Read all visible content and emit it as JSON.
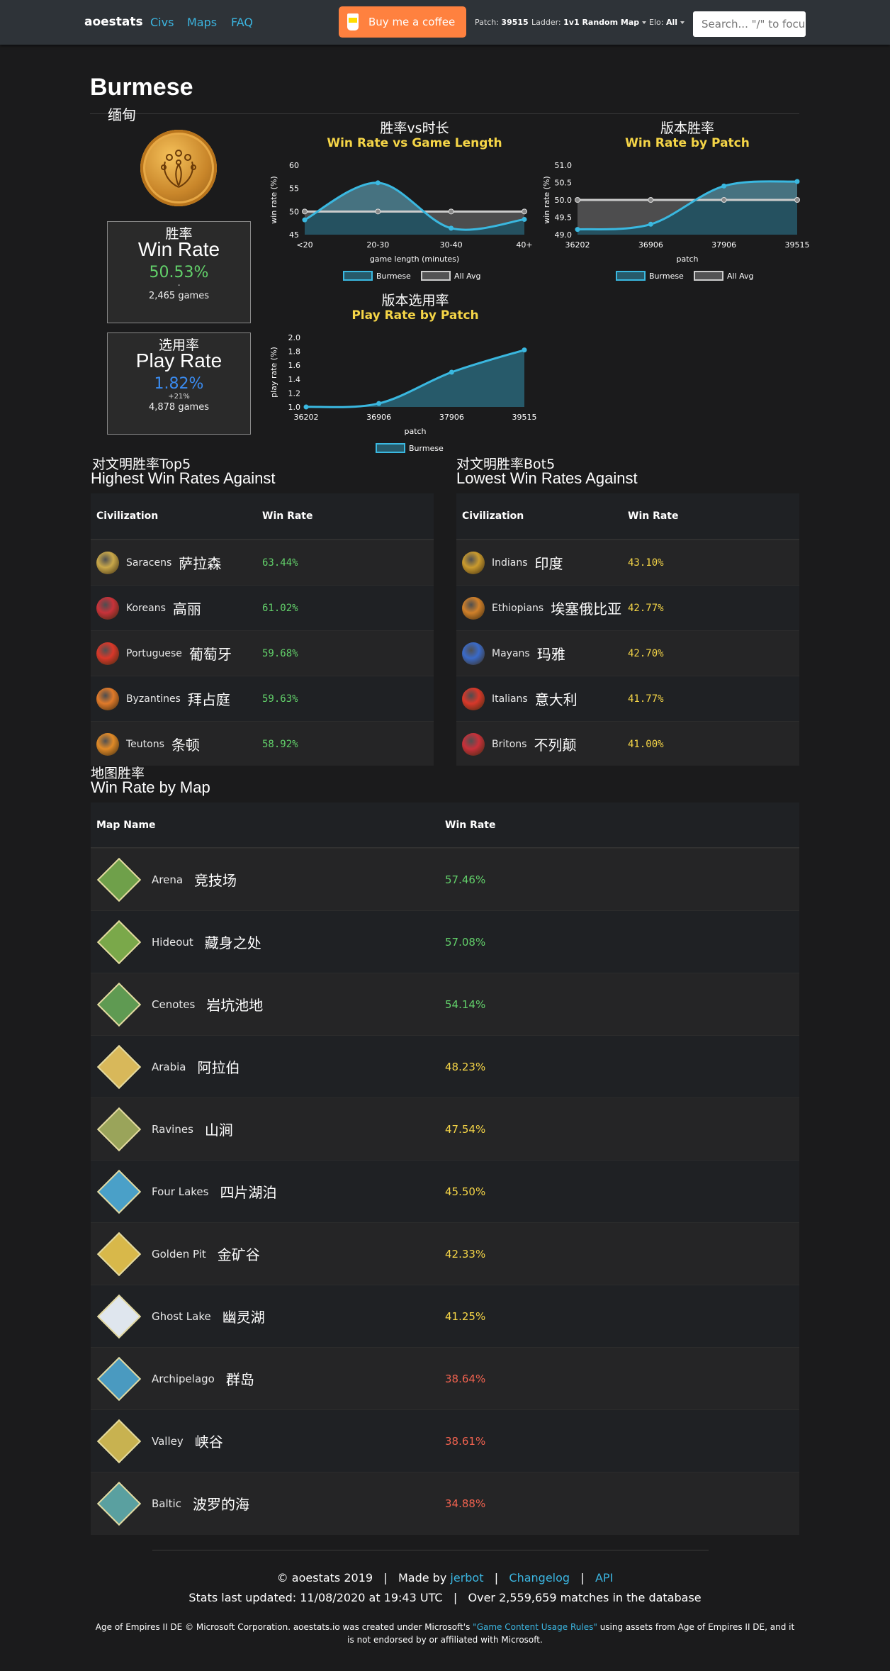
{
  "nav": {
    "brand": "aoestats",
    "links": [
      "Civs",
      "Maps",
      "FAQ"
    ],
    "coffee": "Buy me a coffee",
    "patch_label": "Patch:",
    "patch_value": "39515",
    "ladder_label": "Ladder:",
    "ladder_value": "1v1 Random Map",
    "elo_label": "Elo:",
    "elo_value": "All",
    "search_placeholder": "Search... \"/\" to focus"
  },
  "civ": {
    "name": "Burmese",
    "name_cn": "缅甸"
  },
  "winrate_box": {
    "cn": "胜率",
    "en": "Win Rate",
    "value": "50.53%",
    "delta": "-",
    "games": "2,465 games",
    "color": "#62d06a"
  },
  "playrate_box": {
    "cn": "选用率",
    "en": "Play Rate",
    "value": "1.82%",
    "delta": "+21%",
    "games": "4,878 games",
    "color": "#3a8bf0"
  },
  "charts": {
    "length": {
      "cn": "胜率vs时长",
      "en": "Win Rate vs Game Length"
    },
    "patch": {
      "cn": "版本胜率",
      "en": "Win Rate by Patch"
    },
    "play": {
      "cn": "版本选用率",
      "en": "Play Rate by Patch"
    }
  },
  "chart_data": [
    {
      "type": "line",
      "title": "Win Rate vs Game Length",
      "x": [
        "<20",
        "20-30",
        "30-40",
        "40+"
      ],
      "xlabel": "game length (minutes)",
      "ylabel": "win rate (%)",
      "ylim": [
        45,
        60
      ],
      "yticks": [
        "60",
        "55",
        "50",
        "45"
      ],
      "series": [
        {
          "name": "Burmese",
          "values": [
            48.2,
            56.2,
            46.4,
            48.3
          ]
        },
        {
          "name": "All Avg",
          "values": [
            50,
            50,
            50,
            50
          ]
        }
      ]
    },
    {
      "type": "line",
      "title": "Win Rate by Patch",
      "x": [
        "36202",
        "36906",
        "37906",
        "39515"
      ],
      "xlabel": "patch",
      "ylabel": "win rate (%)",
      "ylim": [
        49.0,
        51.0
      ],
      "yticks": [
        "51.0",
        "50.5",
        "50.0",
        "49.5",
        "49.0"
      ],
      "series": [
        {
          "name": "Burmese",
          "values": [
            49.15,
            49.3,
            50.4,
            50.53
          ]
        },
        {
          "name": "All Avg",
          "values": [
            50,
            50,
            50,
            50
          ]
        }
      ]
    },
    {
      "type": "line",
      "title": "Play Rate by Patch",
      "x": [
        "36202",
        "36906",
        "37906",
        "39515"
      ],
      "xlabel": "patch",
      "ylabel": "play rate (%)",
      "ylim": [
        1.0,
        2.0
      ],
      "yticks": [
        "2.0",
        "1.8",
        "1.6",
        "1.4",
        "1.2",
        "1.0"
      ],
      "series": [
        {
          "name": "Burmese",
          "values": [
            1.0,
            1.05,
            1.5,
            1.82
          ]
        }
      ]
    }
  ],
  "highest": {
    "cn": "对文明胜率Top5",
    "en": "Highest Win Rates Against",
    "col1": "Civilization",
    "col2": "Win Rate",
    "rows": [
      {
        "name": "Saracens",
        "cn": "萨拉森",
        "rate": "63.44%",
        "color": "#c9a84a"
      },
      {
        "name": "Koreans",
        "cn": "高丽",
        "rate": "61.02%",
        "color": "#c8323a"
      },
      {
        "name": "Portuguese",
        "cn": "葡萄牙",
        "rate": "59.68%",
        "color": "#d8382a"
      },
      {
        "name": "Byzantines",
        "cn": "拜占庭",
        "rate": "59.63%",
        "color": "#e07a2a"
      },
      {
        "name": "Teutons",
        "cn": "条顿",
        "rate": "58.92%",
        "color": "#e08a28"
      }
    ]
  },
  "lowest": {
    "cn": "对文明胜率Bot5",
    "en": "Lowest Win Rates Against",
    "col1": "Civilization",
    "col2": "Win Rate",
    "rows": [
      {
        "name": "Indians",
        "cn": "印度",
        "rate": "43.10%",
        "color": "#c99a2e"
      },
      {
        "name": "Ethiopians",
        "cn": "埃塞俄比亚",
        "rate": "42.77%",
        "color": "#d0802a"
      },
      {
        "name": "Mayans",
        "cn": "玛雅",
        "rate": "42.70%",
        "color": "#3a6ac8"
      },
      {
        "name": "Italians",
        "cn": "意大利",
        "rate": "41.77%",
        "color": "#d8382a"
      },
      {
        "name": "Britons",
        "cn": "不列颠",
        "rate": "41.00%",
        "color": "#c8303a"
      }
    ]
  },
  "maps": {
    "cn": "地图胜率",
    "en": "Win Rate by Map",
    "col1": "Map Name",
    "col2": "Win Rate",
    "rows": [
      {
        "name": "Arena",
        "cn": "竞技场",
        "rate": "57.46%",
        "tier": "green",
        "color": "#6fa04a"
      },
      {
        "name": "Hideout",
        "cn": "藏身之处",
        "rate": "57.08%",
        "tier": "green",
        "color": "#7aa84a"
      },
      {
        "name": "Cenotes",
        "cn": "岩坑池地",
        "rate": "54.14%",
        "tier": "green",
        "color": "#5f9a52"
      },
      {
        "name": "Arabia",
        "cn": "阿拉伯",
        "rate": "48.23%",
        "tier": "yellow",
        "color": "#d8b85a"
      },
      {
        "name": "Ravines",
        "cn": "山涧",
        "rate": "47.54%",
        "tier": "yellow",
        "color": "#9aa45a"
      },
      {
        "name": "Four Lakes",
        "cn": "四片湖泊",
        "rate": "45.50%",
        "tier": "yellow",
        "color": "#4aa0c8"
      },
      {
        "name": "Golden Pit",
        "cn": "金矿谷",
        "rate": "42.33%",
        "tier": "yellow",
        "color": "#d8b84a"
      },
      {
        "name": "Ghost Lake",
        "cn": "幽灵湖",
        "rate": "41.25%",
        "tier": "yellow",
        "color": "#dfe6ee"
      },
      {
        "name": "Archipelago",
        "cn": "群岛",
        "rate": "38.64%",
        "tier": "red",
        "color": "#4a9ac0"
      },
      {
        "name": "Valley",
        "cn": "峡谷",
        "rate": "38.61%",
        "tier": "red",
        "color": "#c8b250"
      },
      {
        "name": "Baltic",
        "cn": "波罗的海",
        "rate": "34.88%",
        "tier": "red",
        "color": "#5aa0a0"
      }
    ]
  },
  "footer": {
    "copy": "© aoestats 2019",
    "madeby": "Made by",
    "author": "jerbot",
    "changelog": "Changelog",
    "api": "API",
    "updated": "Stats last updated: 11/08/2020 at 19:43 UTC",
    "matches": "Over 2,559,659 matches in the database",
    "legal_a": "Age of Empires II DE © Microsoft Corporation. aoestats.io was created under Microsoft's ",
    "legal_link": "\"Game Content Usage Rules\"",
    "legal_b": " using assets from Age of Empires II DE, and it is not endorsed by or affiliated with Microsoft."
  },
  "colors": {
    "burmese_line": "#3ab8e0",
    "avg_line": "#cccccc",
    "title_yellow": "#f5d547"
  }
}
